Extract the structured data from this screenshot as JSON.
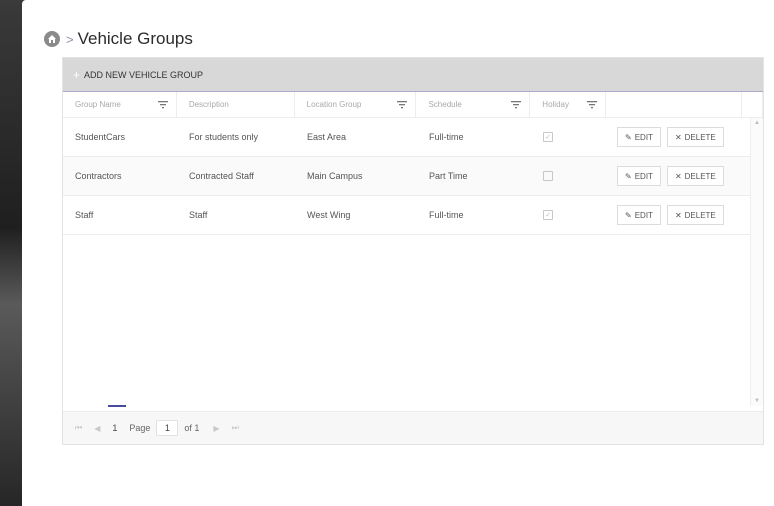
{
  "breadcrumb": {
    "separator": ">",
    "title": "Vehicle Groups"
  },
  "toolbar": {
    "add_label": "ADD NEW VEHICLE GROUP"
  },
  "columns": {
    "group_name": "Group Name",
    "description": "Description",
    "location_group": "Location Group",
    "schedule": "Schedule",
    "holiday": "Holiday"
  },
  "rows": [
    {
      "group_name": "StudentCars",
      "description": "For students only",
      "location_group": "East Area",
      "schedule": "Full-time",
      "holiday": true,
      "edit": "EDIT",
      "delete": "DELETE"
    },
    {
      "group_name": "Contractors",
      "description": "Contracted Staff",
      "location_group": "Main Campus",
      "schedule": "Part Time",
      "holiday": false,
      "edit": "EDIT",
      "delete": "DELETE"
    },
    {
      "group_name": "Staff",
      "description": "Staff",
      "location_group": "West Wing",
      "schedule": "Full-time",
      "holiday": true,
      "edit": "EDIT",
      "delete": "DELETE"
    }
  ],
  "pager": {
    "current_page": "1",
    "page_label": "Page",
    "page_value": "1",
    "of_label": "of 1"
  },
  "icons": {
    "home": "home-icon",
    "add": "plus-icon",
    "filter": "filter-icon",
    "edit": "pencil-icon",
    "delete": "x-icon",
    "checkbox": "checkbox-icon"
  },
  "colors": {
    "toolbar_bg": "#d8d8d8",
    "pager_active": "#4a4aa0",
    "background": "#2a2a2a"
  }
}
